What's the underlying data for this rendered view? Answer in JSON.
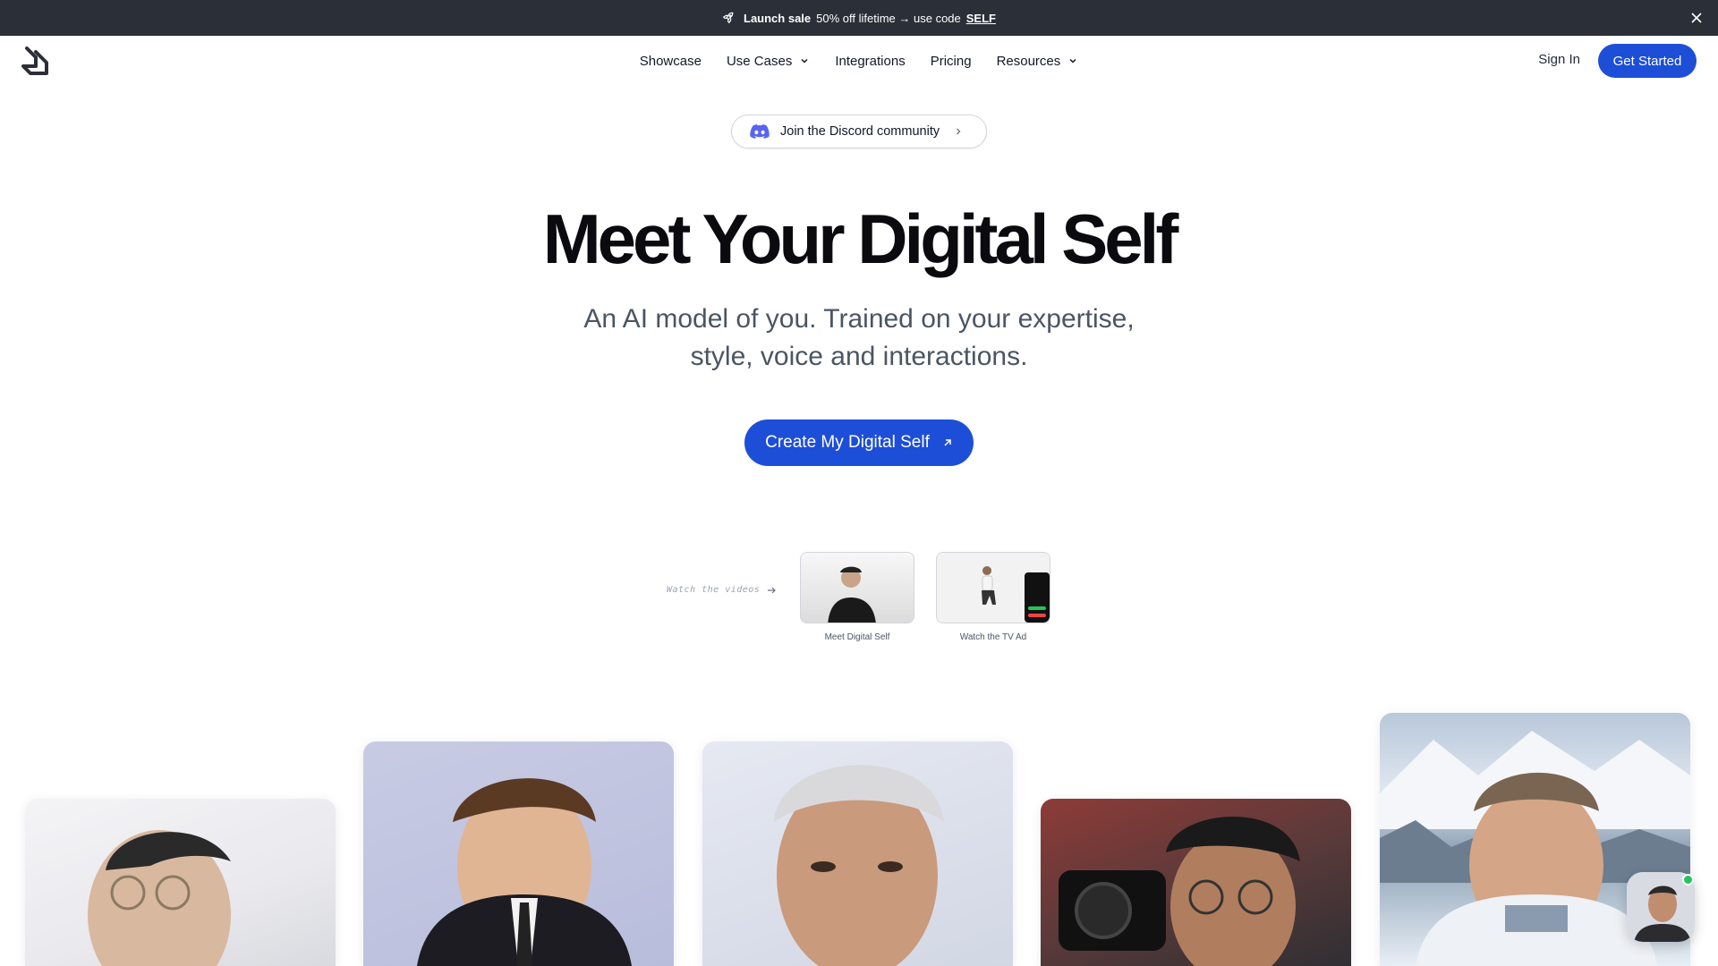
{
  "announcement": {
    "label": "Launch sale",
    "text": "50% off lifetime → use code",
    "code": "SELF"
  },
  "nav": {
    "items": [
      {
        "label": "Showcase",
        "dropdown": false
      },
      {
        "label": "Use Cases",
        "dropdown": true
      },
      {
        "label": "Integrations",
        "dropdown": false
      },
      {
        "label": "Pricing",
        "dropdown": false
      },
      {
        "label": "Resources",
        "dropdown": true
      }
    ],
    "sign_in": "Sign In",
    "get_started": "Get Started"
  },
  "discord": {
    "label": "Join the Discord community"
  },
  "hero": {
    "title": "Meet Your Digital Self",
    "subtitle_line1": "An AI model of you. Trained on your expertise,",
    "subtitle_line2": "style, voice and interactions.",
    "cta": "Create My Digital Self"
  },
  "videos": {
    "label": "Watch the videos",
    "items": [
      {
        "caption": "Meet Digital Self"
      },
      {
        "caption": "Watch the TV Ad"
      }
    ]
  },
  "colors": {
    "accent": "#1d4ed8",
    "announce_bg": "#2b2f37",
    "online": "#22c55e"
  }
}
